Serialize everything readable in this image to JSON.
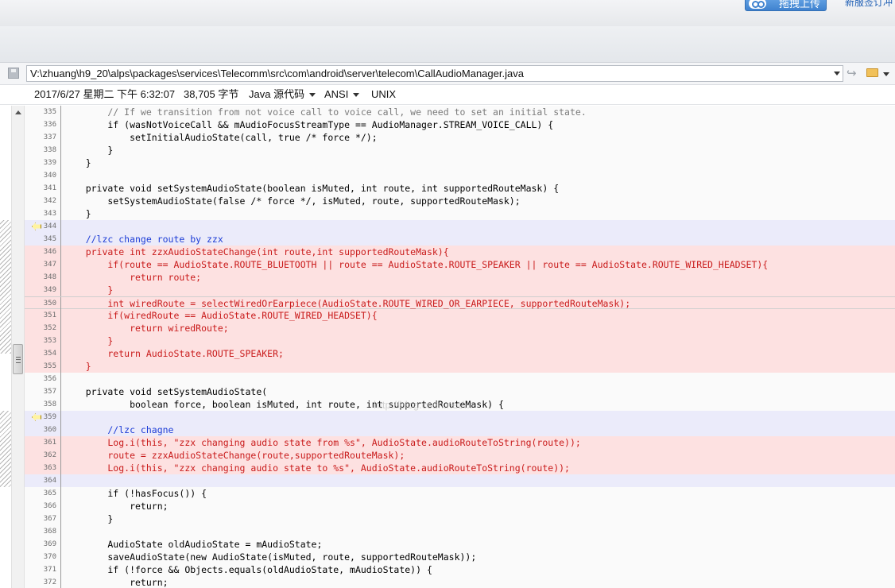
{
  "toolbar": {
    "upload_label": "拖拽上传",
    "top_link": "新服签订冲"
  },
  "path_bar": {
    "path": "V:\\zhuang\\h9_20\\alps\\packages\\services\\Telecomm\\src\\com\\android\\server\\telecom\\CallAudioManager.java"
  },
  "file_info": {
    "modified": "2017/6/27 星期二 下午 6:32:07",
    "size": "38,705 字节",
    "language": "Java 源代码",
    "encoding": "ANSI",
    "line_ending": "UNIX"
  },
  "watermark": "http://blog.csdn.net/...",
  "code_lines": [
    {
      "num": "335",
      "bg": "norm",
      "text": "        // If we transition from not voice call to voice call, we need to set an initial state.",
      "color": "cmt"
    },
    {
      "num": "336",
      "bg": "norm",
      "text": "        if (wasNotVoiceCall && mAudioFocusStreamType == AudioManager.STREAM_VOICE_CALL) {",
      "color": "def"
    },
    {
      "num": "337",
      "bg": "norm",
      "text": "            setInitialAudioState(call, true /* force */);",
      "color": "def"
    },
    {
      "num": "338",
      "bg": "norm",
      "text": "        }",
      "color": "def"
    },
    {
      "num": "339",
      "bg": "norm",
      "text": "    }",
      "color": "def"
    },
    {
      "num": "340",
      "bg": "norm",
      "text": "",
      "color": "def"
    },
    {
      "num": "341",
      "bg": "norm",
      "text": "    private void setSystemAudioState(boolean isMuted, int route, int supportedRouteMask) {",
      "color": "def"
    },
    {
      "num": "342",
      "bg": "norm",
      "text": "        setSystemAudioState(false /* force */, isMuted, route, supportedRouteMask);",
      "color": "def"
    },
    {
      "num": "343",
      "bg": "norm",
      "text": "    }",
      "color": "def"
    },
    {
      "num": "344",
      "bg": "blue",
      "text": "",
      "color": "def",
      "marker": true
    },
    {
      "num": "345",
      "bg": "blue",
      "text": "    //lzc change route by zzx",
      "color": "blue"
    },
    {
      "num": "346",
      "bg": "red",
      "text": "    private int zzxAudioStateChange(int route,int supportedRouteMask){",
      "color": "red"
    },
    {
      "num": "347",
      "bg": "red",
      "text": "        if(route == AudioState.ROUTE_BLUETOOTH || route == AudioState.ROUTE_SPEAKER || route == AudioState.ROUTE_WIRED_HEADSET){",
      "color": "red"
    },
    {
      "num": "348",
      "bg": "red",
      "text": "            return route;",
      "color": "red"
    },
    {
      "num": "349",
      "bg": "red",
      "text": "        }",
      "color": "red"
    },
    {
      "num": "350",
      "bg": "red",
      "text": "        int wiredRoute = selectWiredOrEarpiece(AudioState.ROUTE_WIRED_OR_EARPIECE, supportedRouteMask);",
      "color": "red",
      "cursor": true
    },
    {
      "num": "351",
      "bg": "red",
      "text": "        if(wiredRoute == AudioState.ROUTE_WIRED_HEADSET){",
      "color": "red"
    },
    {
      "num": "352",
      "bg": "red",
      "text": "            return wiredRoute;",
      "color": "red"
    },
    {
      "num": "353",
      "bg": "red",
      "text": "        }",
      "color": "red"
    },
    {
      "num": "354",
      "bg": "red",
      "text": "        return AudioState.ROUTE_SPEAKER;",
      "color": "red"
    },
    {
      "num": "355",
      "bg": "red",
      "text": "    }",
      "color": "red"
    },
    {
      "num": "356",
      "bg": "norm",
      "text": "",
      "color": "def"
    },
    {
      "num": "357",
      "bg": "norm",
      "text": "    private void setSystemAudioState(",
      "color": "def"
    },
    {
      "num": "358",
      "bg": "norm",
      "text": "            boolean force, boolean isMuted, int route, int supportedRouteMask) {",
      "color": "def"
    },
    {
      "num": "359",
      "bg": "blue",
      "text": "",
      "color": "def",
      "marker": true
    },
    {
      "num": "360",
      "bg": "blue",
      "text": "        //lzc chagne",
      "color": "blue"
    },
    {
      "num": "361",
      "bg": "red",
      "text": "        Log.i(this, \"zzx changing audio state from %s\", AudioState.audioRouteToString(route));",
      "color": "red"
    },
    {
      "num": "362",
      "bg": "red",
      "text": "        route = zzxAudioStateChange(route,supportedRouteMask);",
      "color": "red"
    },
    {
      "num": "363",
      "bg": "red",
      "text": "        Log.i(this, \"zzx changing audio state to %s\", AudioState.audioRouteToString(route));",
      "color": "red"
    },
    {
      "num": "364",
      "bg": "blue",
      "text": "",
      "color": "def"
    },
    {
      "num": "365",
      "bg": "norm",
      "text": "        if (!hasFocus()) {",
      "color": "def"
    },
    {
      "num": "366",
      "bg": "norm",
      "text": "            return;",
      "color": "def"
    },
    {
      "num": "367",
      "bg": "norm",
      "text": "        }",
      "color": "def"
    },
    {
      "num": "368",
      "bg": "norm",
      "text": "",
      "color": "def"
    },
    {
      "num": "369",
      "bg": "norm",
      "text": "        AudioState oldAudioState = mAudioState;",
      "color": "def"
    },
    {
      "num": "370",
      "bg": "norm",
      "text": "        saveAudioState(new AudioState(isMuted, route, supportedRouteMask));",
      "color": "def"
    },
    {
      "num": "371",
      "bg": "norm",
      "text": "        if (!force && Objects.equals(oldAudioState, mAudioState)) {",
      "color": "def"
    },
    {
      "num": "372",
      "bg": "norm",
      "text": "            return;",
      "color": "def"
    }
  ]
}
